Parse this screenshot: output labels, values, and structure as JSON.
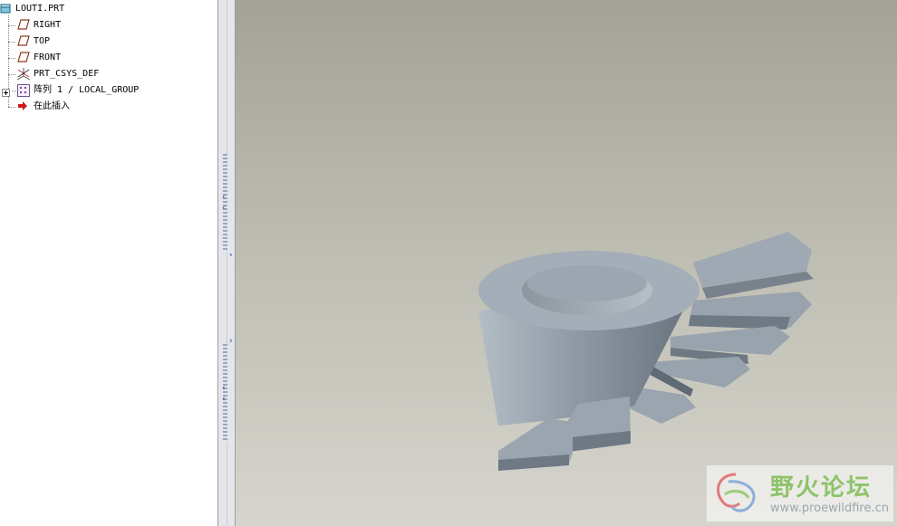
{
  "model_tree": {
    "root": {
      "label": "LOUTI.PRT",
      "icon": "part-icon"
    },
    "items": [
      {
        "label": "RIGHT",
        "icon": "datum-plane-icon"
      },
      {
        "label": "TOP",
        "icon": "datum-plane-icon"
      },
      {
        "label": "FRONT",
        "icon": "datum-plane-icon"
      },
      {
        "label": "PRT_CSYS_DEF",
        "icon": "coordinate-system-icon"
      },
      {
        "label": "阵列 1 / LOCAL_GROUP",
        "icon": "pattern-icon",
        "expandable": true
      },
      {
        "label": "在此插入",
        "icon": "insert-here-arrow-icon"
      }
    ]
  },
  "watermark": {
    "title": "野火论坛",
    "url": "www.proewildfire.cn"
  },
  "colors": {
    "part_face": "#8e99a4",
    "part_top": "#a6b1bb",
    "background_top": "#a3a296",
    "background_bottom": "#d6d5cd"
  }
}
